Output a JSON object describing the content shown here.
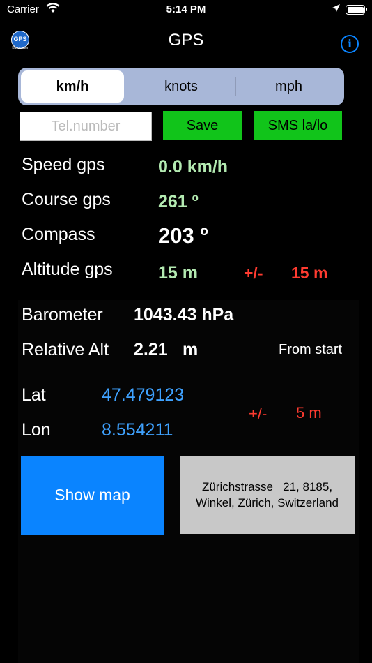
{
  "status": {
    "carrier": "Carrier",
    "time": "5:14 PM"
  },
  "nav": {
    "logo_text": "GPS",
    "logo_sub": "Barometer",
    "title": "GPS"
  },
  "units": {
    "options": [
      "km/h",
      "knots",
      "mph"
    ],
    "selected": "km/h"
  },
  "sms": {
    "placeholder": "Tel.number",
    "value": "",
    "save_label": "Save",
    "sms_label": "SMS la/lo"
  },
  "readings": {
    "speed_label": "Speed gps",
    "speed_value": "0.0 km/h",
    "course_label": "Course gps",
    "course_value": "261 º",
    "compass_label": "Compass",
    "compass_value": "203 º",
    "altitude_label": "Altitude gps",
    "altitude_value": "15 m",
    "altitude_pm": "+/-",
    "altitude_accuracy": "15 m"
  },
  "barometer": {
    "label": "Barometer",
    "value": "1043.43 hPa",
    "rel_label": "Relative Alt",
    "rel_value": "2.21",
    "rel_unit": "m",
    "from_start": "From start"
  },
  "position": {
    "lat_label": "Lat",
    "lat_value": "47.479123",
    "lon_label": "Lon",
    "lon_value": "8.554211",
    "pm": "+/-",
    "accuracy": "5 m"
  },
  "map": {
    "button_label": "Show map",
    "address_line1": "Zürichstrasse   21, 8185,",
    "address_line2": "Winkel, Zürich, Switzerland"
  }
}
